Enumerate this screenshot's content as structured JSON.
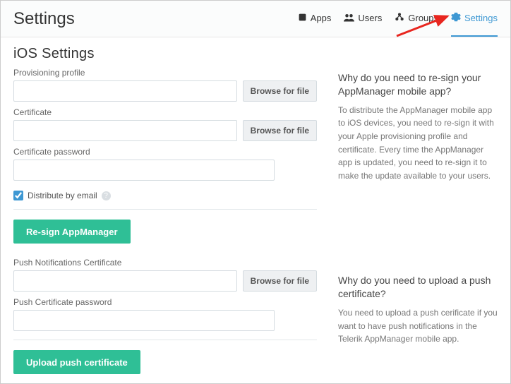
{
  "header": {
    "title": "Settings",
    "tabs": [
      {
        "label": "Apps"
      },
      {
        "label": "Users"
      },
      {
        "label": "Groups"
      },
      {
        "label": "Settings"
      }
    ]
  },
  "page": {
    "title": "iOS Settings"
  },
  "resign": {
    "provisioning_label": "Provisioning profile",
    "certificate_label": "Certificate",
    "cert_password_label": "Certificate password",
    "browse_label": "Browse for file",
    "distribute_label": "Distribute by email",
    "distribute_checked": true,
    "action_label": "Re-sign AppManager"
  },
  "push": {
    "cert_label": "Push Notifications Certificate",
    "cert_password_label": "Push Certificate password",
    "browse_label": "Browse for file",
    "action_label": "Upload push certificate"
  },
  "help": {
    "resign_title": "Why do you need to re-sign your AppManager mobile app?",
    "resign_text": "To distribute the AppManager mobile app to iOS devices, you need to re-sign it with your Apple provisioning profile and certificate. Every time the AppManager app is updated, you need to re-sign it to make the update available to your users.",
    "push_title": "Why do you need to upload a push certificate?",
    "push_text": "You need to upload a push cerificate if you want to have push notifications in the Telerik AppManager mobile app."
  }
}
